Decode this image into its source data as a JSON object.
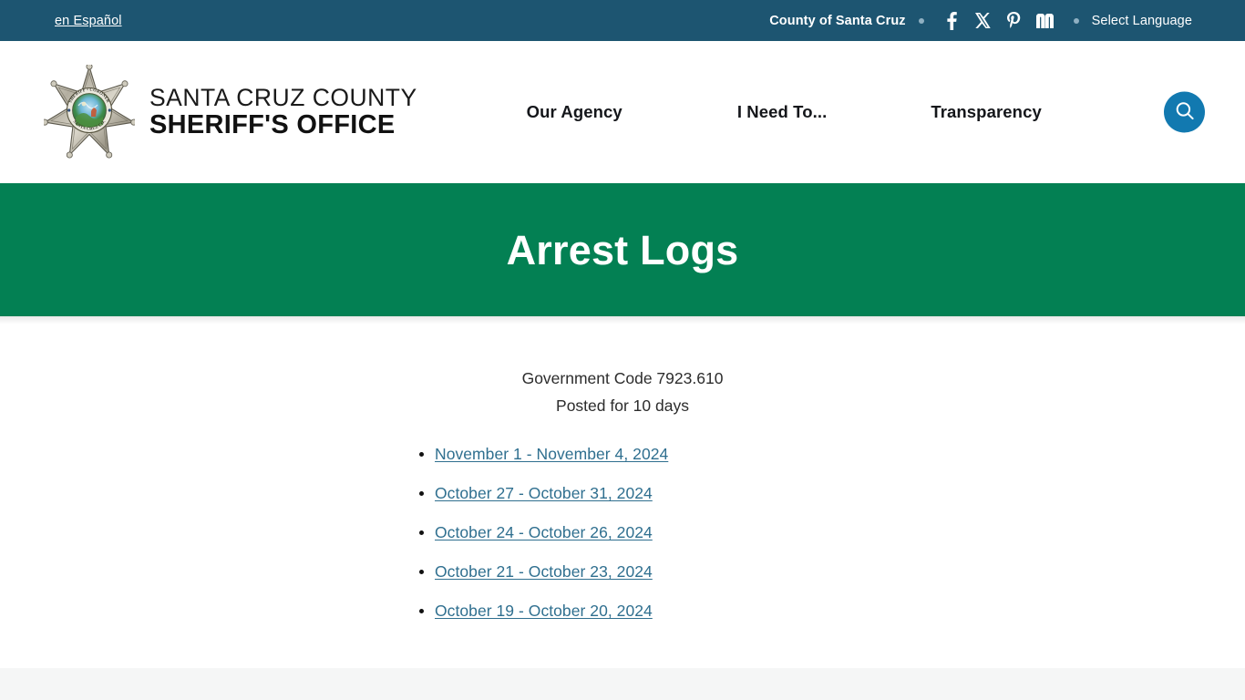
{
  "topbar": {
    "espanol_label": "en Español",
    "county_label": "County of Santa Cruz",
    "language_label": "Select Language",
    "social": [
      {
        "name": "facebook-icon",
        "label": "Facebook"
      },
      {
        "name": "x-twitter-icon",
        "label": "X"
      },
      {
        "name": "pinterest-icon",
        "label": "Pinterest"
      },
      {
        "name": "nextdoor-icon",
        "label": "Nextdoor"
      }
    ],
    "background_color": "#1d5571"
  },
  "header": {
    "brand_line1": "SANTA CRUZ COUNTY",
    "brand_line2": "SHERIFF'S OFFICE",
    "badge_text_top": "SHERIFF • CORONER",
    "badge_text_bottom": "SANTA CRUZ CO.",
    "nav": [
      {
        "label": "Our Agency"
      },
      {
        "label": "I Need To..."
      },
      {
        "label": "Transparency"
      }
    ],
    "search_icon": "search-icon",
    "search_button_color": "#1279b0"
  },
  "banner": {
    "title": "Arrest Logs",
    "background_color": "#038053"
  },
  "content": {
    "intro_line1": "Government Code 7923.610",
    "intro_line2": "Posted for 10 days",
    "links": [
      {
        "label": "November 1 - November 4, 2024"
      },
      {
        "label": "October 27 - October 31, 2024"
      },
      {
        "label": "October 24 - October 26, 2024"
      },
      {
        "label": "October 21 - October 23, 2024"
      },
      {
        "label": "October 19 - October 20, 2024"
      }
    ],
    "link_color": "#2f6f8f"
  }
}
